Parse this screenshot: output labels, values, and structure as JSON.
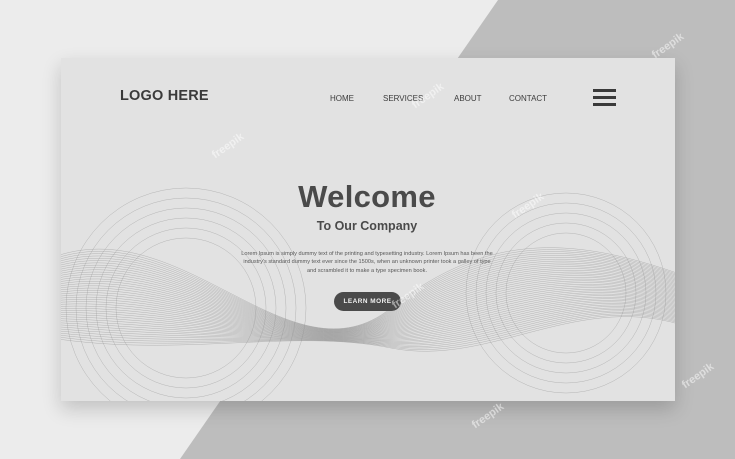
{
  "page": {
    "logo": "LOGO HERE",
    "nav": {
      "home": "HOME",
      "services": "SERVICES",
      "about": "ABOUT",
      "contact": "CONTACT"
    },
    "hero": {
      "title": "Welcome",
      "subtitle": "To Our Company",
      "body": "Lorem Ipsum is simply dummy text of the printing and typesetting industry. Lorem Ipsum has been the industry's standard dummy text ever since the 1500s, when an unknown printer took a galley of type and scrambled it to make a type specimen book.",
      "cta_label": "LEARN MORE"
    },
    "watermark": "freepik"
  },
  "icons": {
    "menu": "hamburger-menu-icon"
  },
  "colors": {
    "background": "#ececec",
    "backdrop_shape": "#bdbdbd",
    "card": "#e2e2e2",
    "text_dark": "#3a3a3a",
    "button": "#4a4a4a",
    "button_text": "#f2f2f2"
  }
}
